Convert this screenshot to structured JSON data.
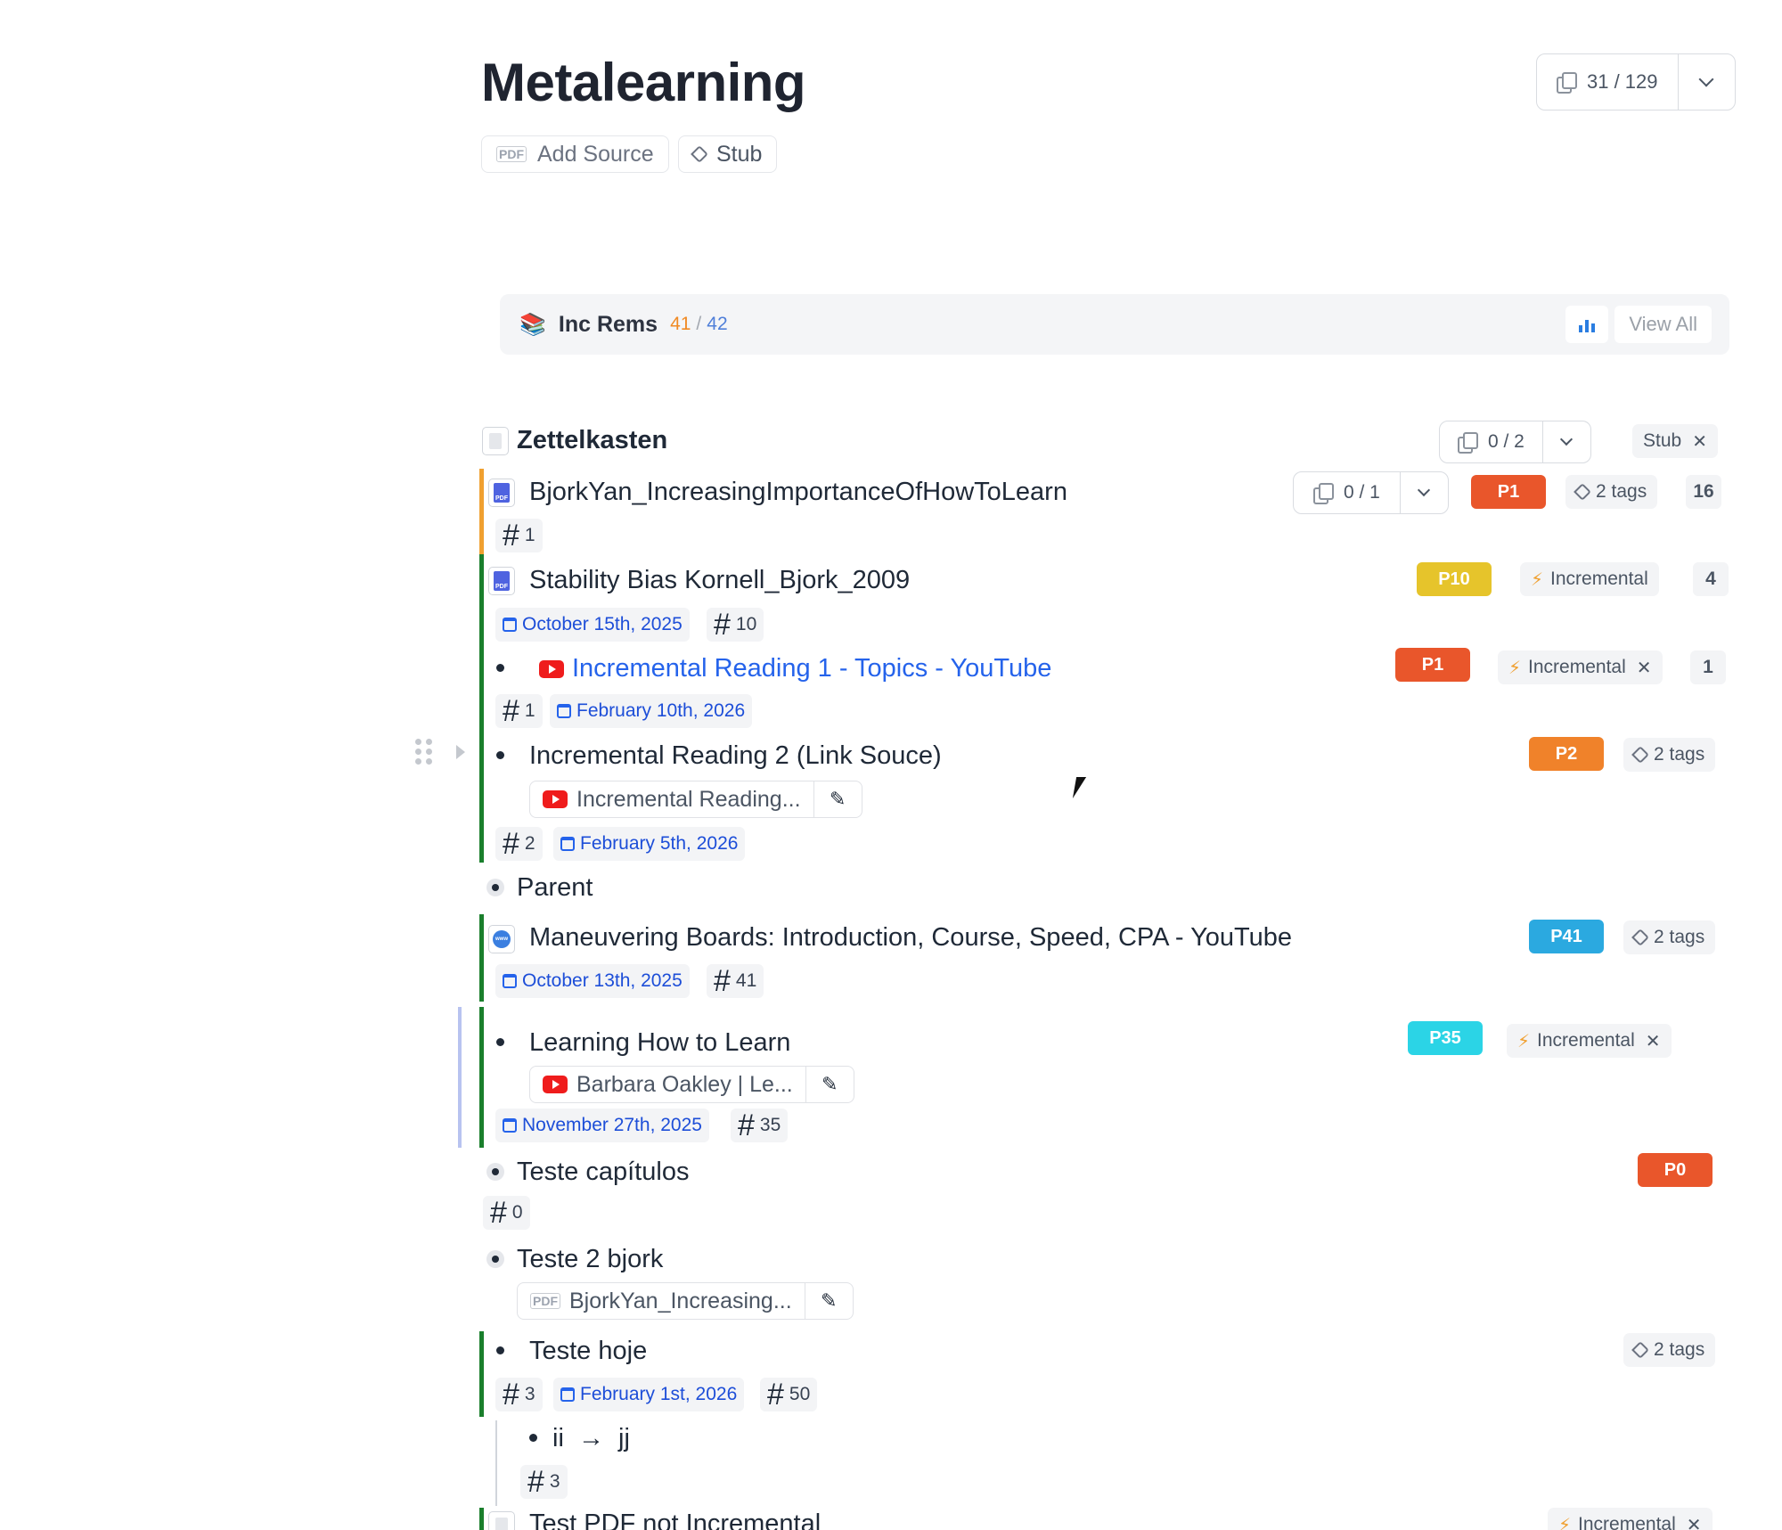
{
  "header": {
    "title": "Metalearning",
    "add_source": "Add Source",
    "stub": "Stub",
    "card_count": "31 / 129"
  },
  "inc_rems": {
    "label": "Inc Rems",
    "count_done": "41",
    "count_total": "42",
    "view_all": "View All"
  },
  "rows": {
    "zettelkasten": {
      "title": "Zettelkasten",
      "cards": "0 / 2",
      "stub_tag": "Stub"
    },
    "bjork": {
      "title": "BjorkYan_IncreasingImportanceOfHowToLearn",
      "cards": "0 / 1",
      "priority": "P1",
      "tags": "2 tags",
      "count": "16",
      "hash": "1"
    },
    "stability": {
      "title": "Stability Bias Kornell_Bjork_2009",
      "priority": "P10",
      "tag": "Incremental",
      "count": "4",
      "date": "October 15th, 2025",
      "hash": "10"
    },
    "ir1": {
      "title": "Incremental Reading 1 - Topics - YouTube",
      "priority": "P1",
      "tag": "Incremental",
      "count": "1",
      "hash": "1",
      "date": "February 10th, 2026"
    },
    "ir2": {
      "title": "Incremental Reading 2 (Link Souce)",
      "priority": "P2",
      "tags": "2 tags",
      "source": "Incremental Reading...",
      "hash": "2",
      "date": "February 5th, 2026"
    },
    "parent": {
      "title": "Parent"
    },
    "maneuvering": {
      "title": "Maneuvering Boards: Introduction, Course, Speed, CPA - YouTube",
      "priority": "P41",
      "tags": "2 tags",
      "date": "October 13th, 2025",
      "hash": "41"
    },
    "learning": {
      "title": "Learning How to Learn",
      "priority": "P35",
      "tag": "Incremental",
      "source": "Barbara Oakley | Le...",
      "date": "November 27th, 2025",
      "hash": "35"
    },
    "teste_cap": {
      "title": "Teste capítulos",
      "priority": "P0",
      "hash": "0"
    },
    "teste2": {
      "title": "Teste 2 bjork",
      "source": "BjorkYan_Increasing..."
    },
    "teste_hoje": {
      "title": "Teste hoje",
      "tags": "2 tags",
      "hash_a": "3",
      "date": "February 1st, 2026",
      "hash_b": "50"
    },
    "ii": {
      "left": "ii",
      "arrow": "→",
      "right": "jj",
      "hash": "3"
    },
    "test_pdf": {
      "title": "Test PDF not Incremental",
      "tag": "Incremental"
    }
  },
  "colors": {
    "P0": "#e9562b",
    "P1": "#e9562b",
    "P2": "#f0822a",
    "P10": "#e6c42b",
    "P35": "#2bd4e6",
    "P41": "#2ba9e0",
    "bar_green": "#1a7f2c",
    "bar_orange": "#f0a030",
    "link": "#2563eb"
  },
  "icons": [
    "pdf-icon",
    "tag-icon",
    "copy-cards-icon",
    "chevron-down-icon",
    "books-icon",
    "bar-chart-icon",
    "document-icon",
    "youtube-icon",
    "globe-icon",
    "calendar-icon",
    "hash-icon",
    "bolt-icon",
    "close-icon",
    "edit-pencil-icon",
    "drag-handle-icon",
    "expand-triangle-icon"
  ]
}
